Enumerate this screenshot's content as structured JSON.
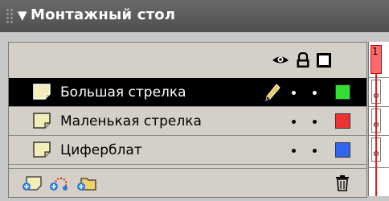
{
  "panel": {
    "title": "Монтажный стол",
    "collapse_icon": "▼"
  },
  "header": {
    "icons": [
      "eye-icon",
      "lock-icon",
      "outline-icon"
    ]
  },
  "layers": [
    {
      "name": "Большая стрелка",
      "selected": true,
      "editing": true,
      "color": "#33dd33"
    },
    {
      "name": "Маленькая стрелка",
      "selected": false,
      "editing": false,
      "color": "#ee3333"
    },
    {
      "name": "Циферблат",
      "selected": false,
      "editing": false,
      "color": "#3366ee"
    }
  ],
  "toolbar": {
    "buttons": [
      "add-layer-icon",
      "add-motion-guide-icon",
      "add-folder-icon",
      "trash-icon"
    ]
  },
  "timeline": {
    "current_frame": "1"
  },
  "colors": {
    "titlebar": "#5a5a5a",
    "selected_row": "#000000",
    "playhead": "#e02020"
  }
}
